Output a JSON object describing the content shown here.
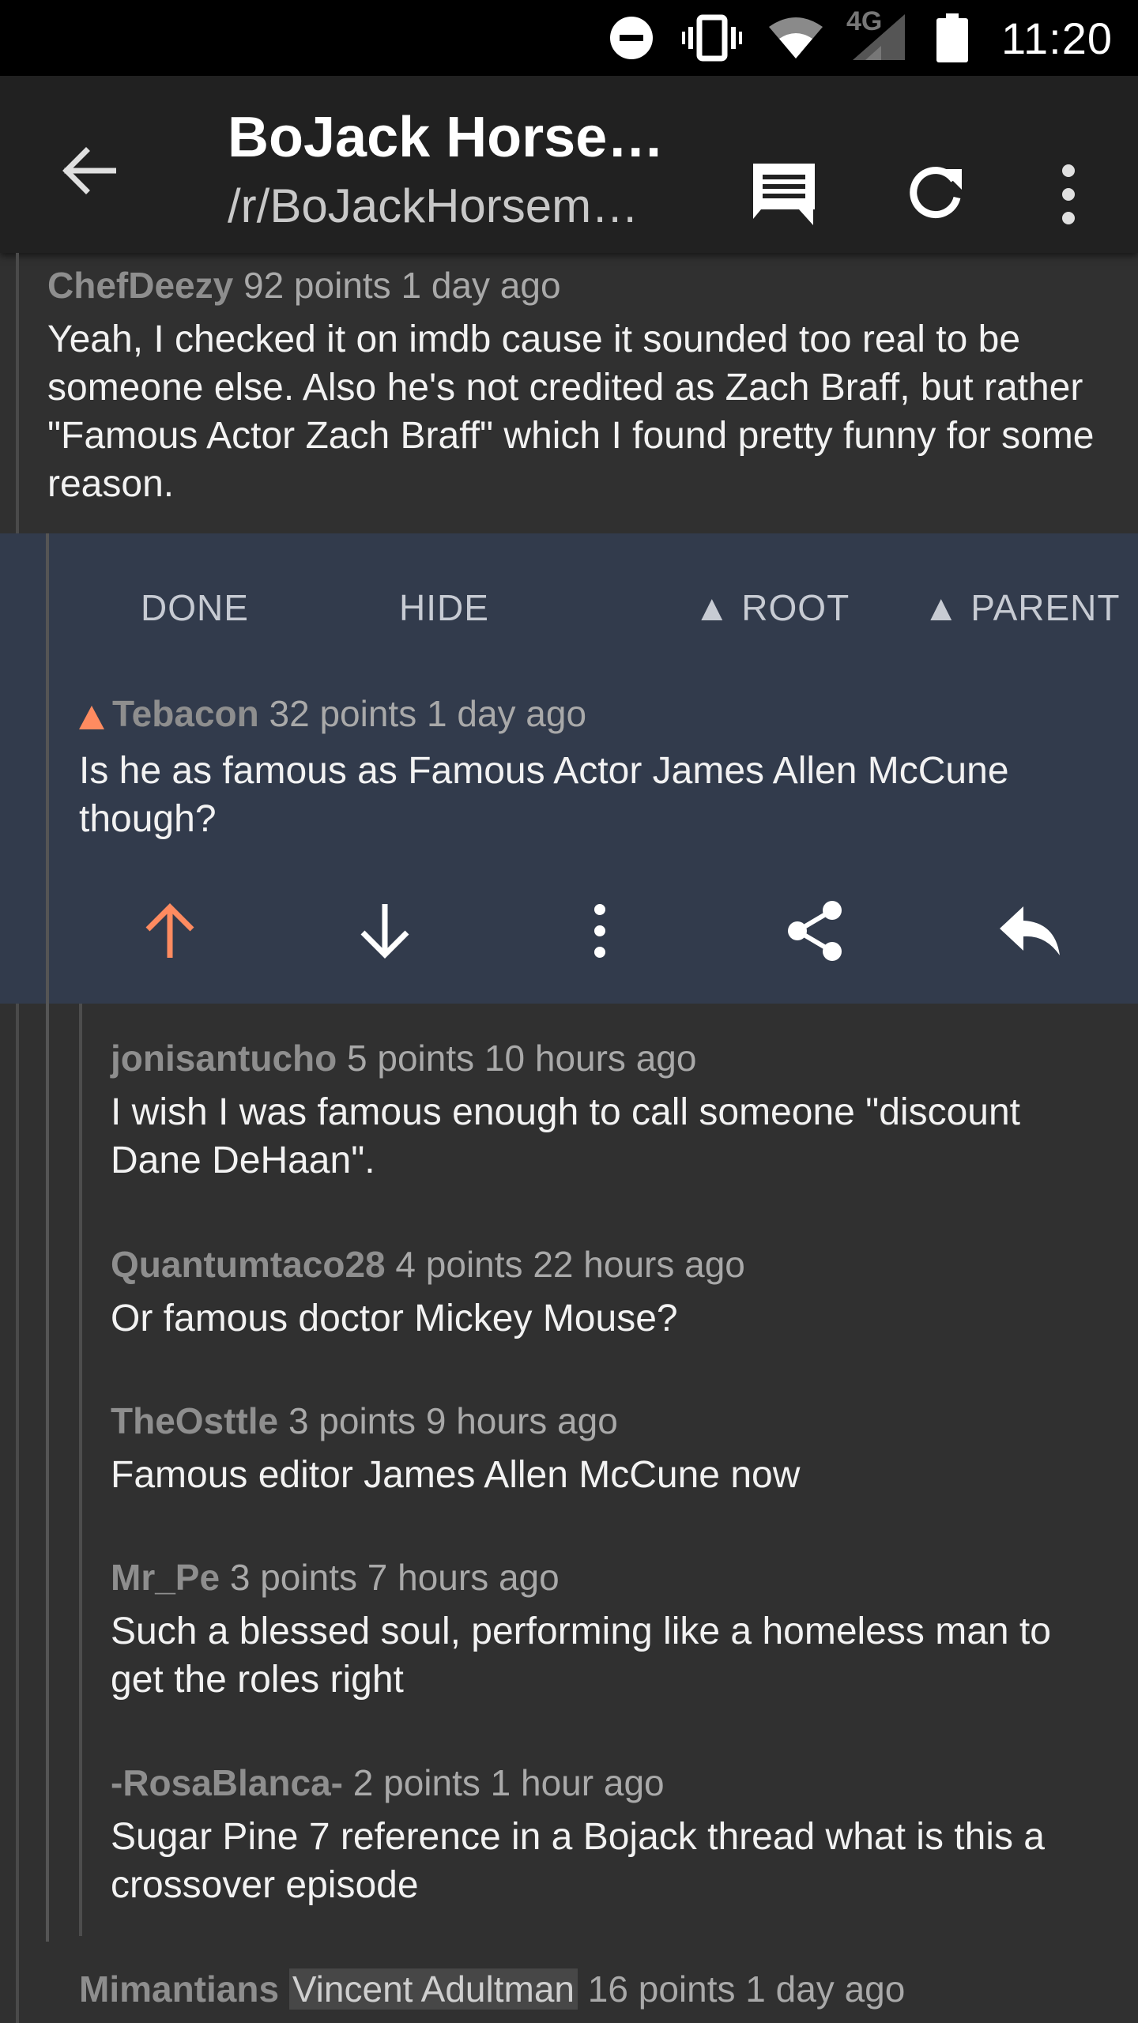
{
  "status_bar": {
    "time": "11:20",
    "network_label": "4G",
    "icons": [
      "dnd-icon",
      "vibrate-icon",
      "wifi-icon",
      "signal-icon",
      "battery-icon"
    ]
  },
  "toolbar": {
    "title": "BoJack Horse…",
    "subtitle": "/r/BoJackHorsem…",
    "icons": [
      "back-arrow-icon",
      "comment-icon",
      "refresh-icon",
      "more-vert-icon"
    ]
  },
  "comments": {
    "parent": {
      "author": "ChefDeezy",
      "points": "92 points",
      "age": "1 day ago",
      "body": "Yeah, I checked it on imdb cause it sounded too real to be someone else. Also he's not credited as Zach Braff, but rather \"Famous Actor Zach Braff\" which I found pretty funny for some reason."
    },
    "selected": {
      "actions": {
        "done": "DONE",
        "hide": "HIDE",
        "root": "▲ ROOT",
        "parent": "▲ PARENT"
      },
      "author": "Tebacon",
      "points": "32 points",
      "age": "1 day ago",
      "body": "Is he as famous as Famous Actor James Allen McCune though?",
      "upvote_color": "#ff8b60"
    },
    "replies": [
      {
        "author": "jonisantucho",
        "points": "5 points",
        "age": "10 hours ago",
        "body": "I wish I was famous enough to call someone \"discount Dane DeHaan\"."
      },
      {
        "author": "Quantumtaco28",
        "points": "4 points",
        "age": "22 hours ago",
        "body": "Or famous doctor Mickey Mouse?"
      },
      {
        "author": "TheOsttle",
        "points": "3 points",
        "age": "9 hours ago",
        "body": "Famous editor James Allen McCune now"
      },
      {
        "author": "Mr_Pe",
        "points": "3 points",
        "age": "7 hours ago",
        "body": "Such a blessed soul, performing like a homeless man to get the roles right"
      },
      {
        "author": "-RosaBlanca-",
        "points": "2 points",
        "age": "1 hour ago",
        "body": "Sugar Pine 7 reference in a Bojack thread what is this a crossover episode"
      }
    ],
    "next": {
      "author": "Mimantians",
      "flair": "Vincent Adultman",
      "points": "16 points",
      "age": "1 day ago"
    }
  },
  "colors": {
    "background": "#303030",
    "toolbar": "#212121",
    "selected_background": "#323b4c",
    "accent_orange": "#ff8b60"
  }
}
